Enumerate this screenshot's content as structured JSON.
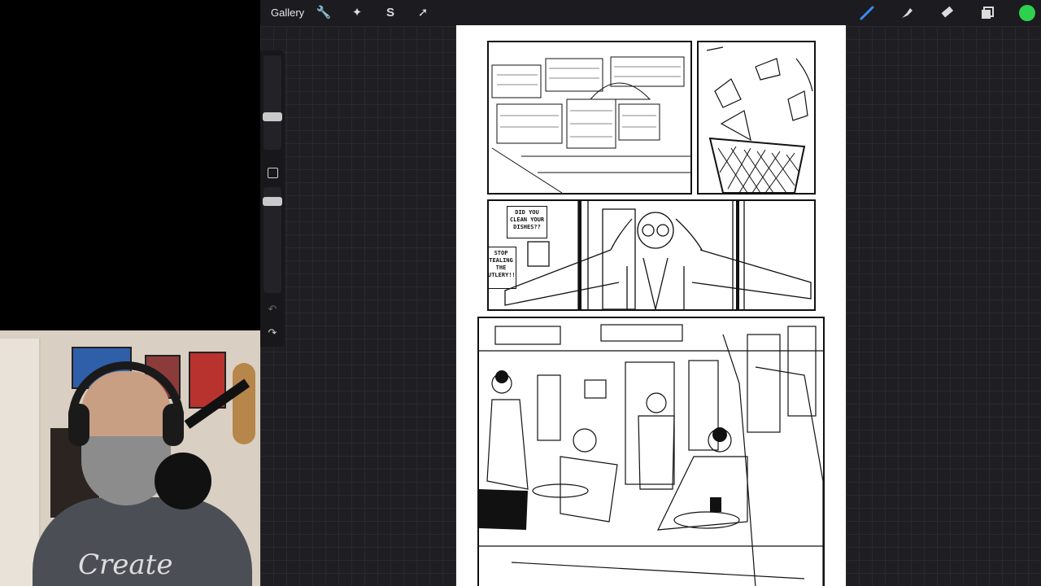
{
  "toolbar": {
    "gallery_label": "Gallery",
    "left_tools": [
      "wrench-icon",
      "magic-wand-icon",
      "selection-icon",
      "transform-icon"
    ],
    "right_tools": [
      "brush-icon",
      "smudge-icon",
      "eraser-icon",
      "layers-icon"
    ],
    "active_color": "#2ed14d"
  },
  "sidebar": {
    "brush_size_level": 0.25,
    "opacity_level": 0.35
  },
  "comic": {
    "sign_dishes": "DID YOU CLEAN YOUR DISHES??",
    "sign_cutlery": "STOP TEALING THE UTLERY!!"
  },
  "webcam": {
    "shirt_text": "Create"
  }
}
